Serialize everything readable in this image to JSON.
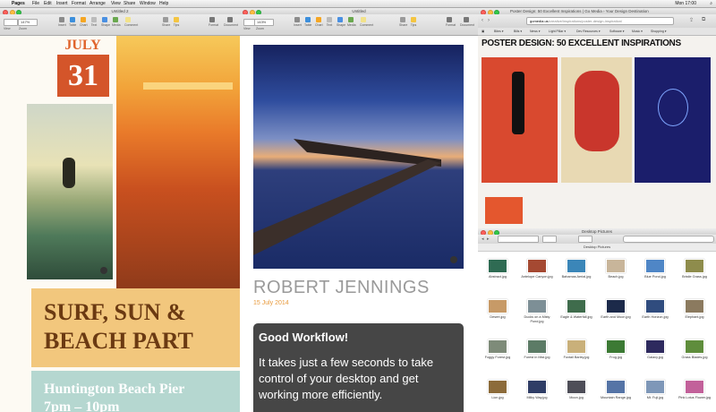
{
  "menubar": {
    "app": "Pages",
    "items": [
      "File",
      "Edit",
      "Insert",
      "Format",
      "Arrange",
      "View",
      "Share",
      "Window",
      "Help"
    ],
    "clock": "Mon 17:00"
  },
  "pages_left": {
    "title": "Untitled 2",
    "zoom": "147%",
    "toolbar_left": [
      "View",
      "Zoom"
    ],
    "toolbar_center": [
      "Insert",
      "Table",
      "Chart",
      "Text",
      "Shape",
      "Media",
      "Comment"
    ],
    "toolbar_right": [
      "Share",
      "Tips",
      "Format",
      "Document"
    ],
    "july_month": "JULY",
    "july_day": "31",
    "surf_line1": "SURF, SUN &",
    "surf_line2": "BEACH PART",
    "location": "Huntington Beach Pier",
    "time": "7pm – 10pm"
  },
  "pages_mid": {
    "title": "Untitled",
    "zoom": "143%",
    "toolbar_left": [
      "View",
      "Zoom"
    ],
    "toolbar_center": [
      "Insert",
      "Table",
      "Chart",
      "Text",
      "Shape",
      "Media",
      "Comment"
    ],
    "toolbar_right": [
      "Share",
      "Tips",
      "Format",
      "Document"
    ],
    "author": "ROBERT JENNINGS",
    "date": "15 July 2014",
    "card_title": "Good Workflow!",
    "card_body": "It takes just a few seconds to take control of your desktop and get working more efficiently."
  },
  "safari": {
    "title": "Poster Design: 50 Excellent Inspirations | Go Media › Your Design Destination",
    "url": "gomedia.us",
    "url_rest": "/creative/inspirations/poster-design-inspiration/",
    "bookmarks": [
      "Bites ▾",
      "Bills ▾",
      "News ▾",
      "Light Pillar ▾",
      "Dev Resources ▾",
      "Software ▾",
      "Music ▾",
      "Shopping ▾"
    ],
    "heading": "POSTER DESIGN: 50 EXCELLENT INSPIRATIONS"
  },
  "finder": {
    "title": "Desktop Pictures",
    "header": "Desktop Pictures",
    "files": [
      "Abstract.jpg",
      "Antelope Canyon.jpg",
      "Bahamas Aerial.jpg",
      "Beach.jpg",
      "Blue Pond.jpg",
      "Bristle Grass.jpg",
      "Desert.jpg",
      "Ducks on a Misty Pond.jpg",
      "Eagle & Waterfall.jpg",
      "Earth and Moon.jpg",
      "Earth Horizon.jpg",
      "Elephant.jpg",
      "Foggy Forest.jpg",
      "Forest in Mist.jpg",
      "Foxtail Barley.jpg",
      "Frog.jpg",
      "Galaxy.jpg",
      "Grass Blades.jpg",
      "Lion.jpg",
      "Milky Way.jpg",
      "Moon.jpg",
      "Mountain Range.jpg",
      "Mt. Fuji.jpg",
      "Pink Lotus Flower.jpg"
    ],
    "thumb_colors": [
      "#2f6b53",
      "#a54932",
      "#3b86b8",
      "#c8b59a",
      "#4f86c6",
      "#8e8c4c",
      "#c79a67",
      "#7d8f96",
      "#3f6c4c",
      "#1c2a4a",
      "#304c7e",
      "#8b7a5f",
      "#7e8b79",
      "#5c7b66",
      "#c9b07a",
      "#3c7a34",
      "#2e2a5e",
      "#5f8d3c",
      "#8c6b3a",
      "#2f3d66",
      "#4e4e58",
      "#5574a6",
      "#7e97b8",
      "#c2619a"
    ]
  }
}
